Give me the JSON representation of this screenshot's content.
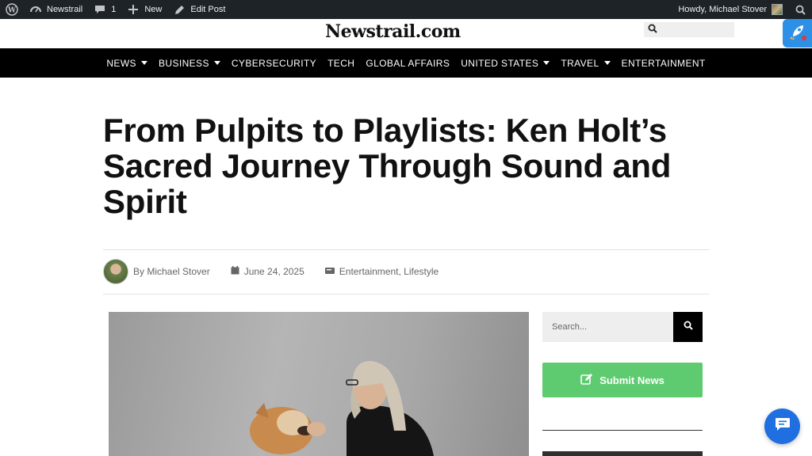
{
  "adminbar": {
    "site_name": "Newstrail",
    "comments_count": "1",
    "new_label": "New",
    "edit_label": "Edit Post",
    "greeting": "Howdy, Michael Stover"
  },
  "header": {
    "logo": "Newstrail.com"
  },
  "nav": {
    "items": [
      {
        "label": "NEWS"
      },
      {
        "label": "BUSINESS"
      },
      {
        "label": "CYBERSECURITY"
      },
      {
        "label": "TECH"
      },
      {
        "label": "GLOBAL AFFAIRS"
      },
      {
        "label": "UNITED STATES"
      },
      {
        "label": "TRAVEL"
      },
      {
        "label": "ENTERTAINMENT"
      }
    ]
  },
  "article": {
    "title": "From Pulpits to Playlists: Ken Holt’s Sacred Journey Through Sound and Spirit",
    "author": "By Michael Stover",
    "date": "June 24, 2025",
    "category_1": "Entertainment",
    "category_sep": ", ",
    "category_2": "Lifestyle"
  },
  "sidebar": {
    "search_placeholder": "Search...",
    "submit_label": "Submit News"
  }
}
